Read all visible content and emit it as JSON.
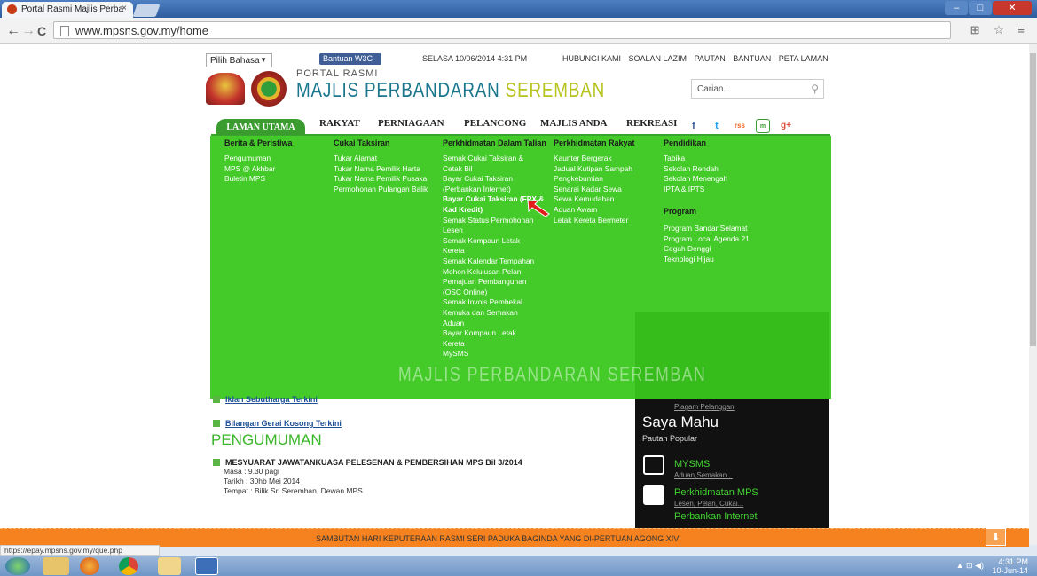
{
  "browser": {
    "tab_title": "Portal Rasmi Majlis Perba",
    "tab_close": "×",
    "url": "www.mpsns.gov.my/home",
    "back": "←",
    "forward": "→",
    "reload": "C",
    "tools": "⊞ ☆ ≡",
    "status_url": "https://epay.mpsns.gov.my/que.php"
  },
  "header": {
    "language": "Pilih Bahasa",
    "bantuan": "Bantuan W3C",
    "date": "SELASA 10/06/2014 4:31 PM",
    "top_links": [
      "HUBUNGI KAMI",
      "SOALAN LAZIM",
      "PAUTAN",
      "BANTUAN",
      "PETA LAMAN"
    ],
    "portal_label": "PORTAL RASMI",
    "title_part1": "MAJLIS PERBANDARAN ",
    "title_part2": "SEREMBAN",
    "search_placeholder": "Carian..."
  },
  "menu": {
    "active": "LAMAN UTAMA",
    "items": [
      "RAKYAT",
      "PERNIAGAAN",
      "PELANCONG",
      "MAJLIS ANDA",
      "REKREASI"
    ],
    "social": [
      "f",
      "t",
      "rss",
      "m",
      "g+"
    ]
  },
  "mega": {
    "headers": [
      "Berita & Peristiwa",
      "Cukai Taksiran",
      "Perkhidmatan Dalam Talian",
      "Perkhidmatan Rakyat",
      "Pendidikan"
    ],
    "berita": [
      "Pengumuman",
      "MPS @ Akhbar",
      "Buletin MPS"
    ],
    "cukai": [
      "Tukar Alamat",
      "Tukar Nama Pemilik Harta",
      "Tukar Nama Pemilik Pusaka",
      "Permohonan Pulangan Balik"
    ],
    "talian": [
      "Semak Cukai Taksiran &",
      "Cetak Bil",
      "Bayar Cukai Taksiran",
      "(Perbankan Internet)",
      "Bayar Cukai Taksiran (FPX &",
      "Kad Kredit)",
      "Semak Status Permohonan",
      "Lesen",
      "Semak Kompaun Letak",
      "Kereta",
      "Semak Kalendar Tempahan",
      "Mohon Kelulusan Pelan",
      "Pemajuan Pembangunan",
      "(OSC Online)",
      "Semak Invois Pembekal",
      "Kemuka dan Semakan",
      "Aduan",
      "Bayar Kompaun Letak",
      "Kereta",
      "MySMS"
    ],
    "rakyat": [
      "Kaunter Bergerak",
      "Jadual Kutipan Sampah",
      "Pengkebumian",
      "Senarai Kadar Sewa",
      "Sewa Kemudahan",
      "Aduan Awam",
      "Letak Kereta Bermeter"
    ],
    "pendidikan": [
      "Tabika",
      "Sekolah Rendah",
      "Sekolah Menengah",
      "IPTA & IPTS"
    ],
    "program_header": "Program",
    "program": [
      "Program Bandar Selamat",
      "Program Local Agenda 21",
      "Cegah Denggi",
      "Teknologi Hijau"
    ],
    "watermark": "MAJLIS PERBANDARAN SEREMBAN"
  },
  "content": {
    "iklan": "Iklan Sebutharga Terkini",
    "bilangan": "Bilangan Gerai Kosong Terkini",
    "pengumuman_title": "PENGUMUMAN",
    "meeting_title": "MESYUARAT JAWATANKUASA PELESENAN & PEMBERSIHAN MPS Bil 3/2014",
    "meeting_lines": [
      "Masa : 9.30 pagi",
      "Tarikh : 30hb Mei 2014",
      "Tempat : Bilik Sri Seremban, Dewan MPS"
    ]
  },
  "right": {
    "piagam": "Piagam Pelanggan",
    "saya_mahu": "Saya Mahu",
    "pautan_popular": "Pautan Popular",
    "links": [
      {
        "title": "MYSMS",
        "sub": "Aduan,Semakan..."
      },
      {
        "title": "Perkhidmatan MPS",
        "sub": "Lesen, Pelan, Cukai..."
      },
      {
        "title": "Perbankan Internet",
        "sub": ""
      }
    ]
  },
  "banner": {
    "text": "SAMBUTAN  HARI KEPUTERAAN RASMI SERI PADUKA BAGINDA YANG DI-PERTUAN AGONG XIV"
  },
  "taskbar": {
    "time": "4:31 PM",
    "date": "10-Jun-14"
  }
}
